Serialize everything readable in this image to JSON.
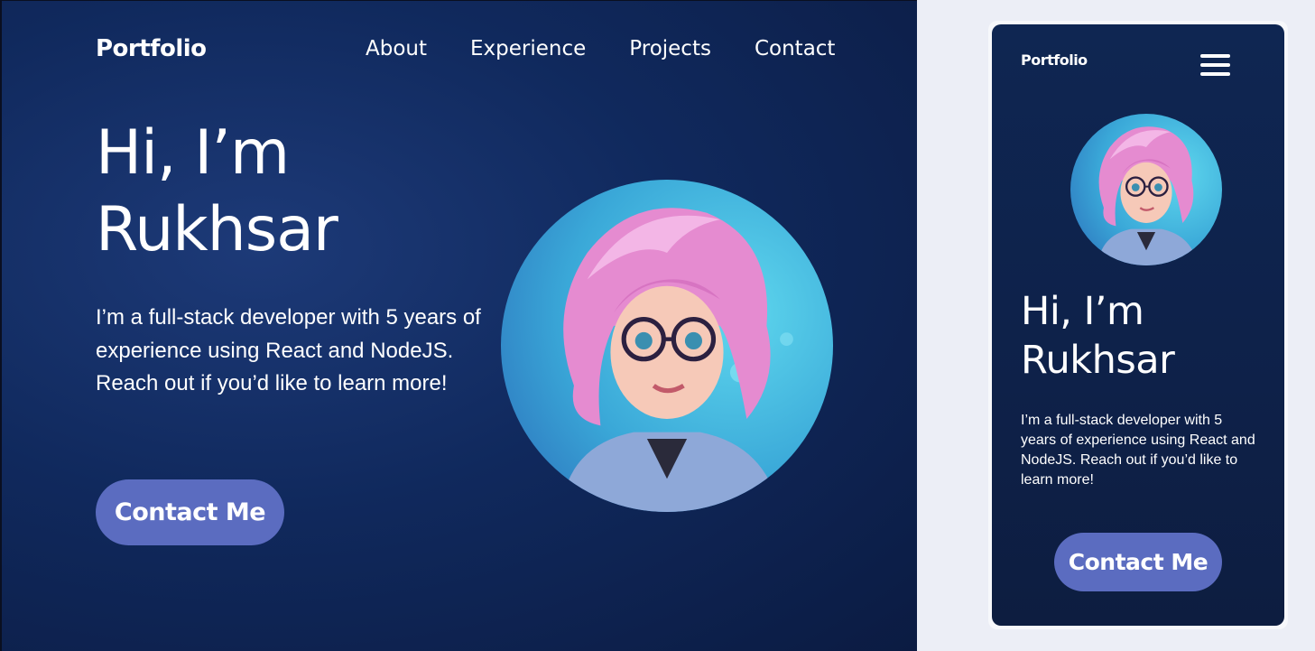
{
  "brand": {
    "name": "Portfolio"
  },
  "nav": {
    "items": [
      "About",
      "Experience",
      "Projects",
      "Contact"
    ]
  },
  "hero": {
    "greeting_line1": "Hi, I’m",
    "greeting_line2": "Rukhsar",
    "description": "I’m a full-stack developer with 5 years of experience using React and NodeJS. Reach out if you’d like to learn more!",
    "cta_label": "Contact Me"
  },
  "mobile": {
    "menu_icon": "hamburger-icon"
  },
  "colors": {
    "background": "#10295d",
    "button": "#5b6cc0",
    "text": "#ffffff",
    "page_bg": "#eceef6"
  }
}
